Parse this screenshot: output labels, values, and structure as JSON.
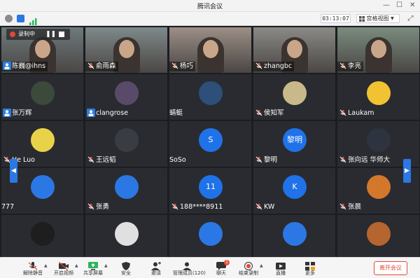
{
  "window": {
    "title": "腾讯会议"
  },
  "toolbar": {
    "timer": "03:13:07",
    "view_label": "宫格视图"
  },
  "recording": {
    "label": "录制中"
  },
  "participants": [
    {
      "name": "陈巍@ihns",
      "type": "video",
      "mic": "blue"
    },
    {
      "name": "俞雨森",
      "type": "video",
      "mic": "muted"
    },
    {
      "name": "杨巧",
      "type": "video",
      "mic": "muted"
    },
    {
      "name": "zhangbc",
      "type": "video",
      "mic": "muted"
    },
    {
      "name": "李亮",
      "type": "video",
      "mic": "muted"
    },
    {
      "name": "张万辉",
      "type": "avatar",
      "mic": "blue"
    },
    {
      "name": "clangrose",
      "type": "avatar",
      "mic": "blue"
    },
    {
      "name": "蜻蜓",
      "type": "avatar",
      "mic": "none"
    },
    {
      "name": "侯知军",
      "type": "avatar",
      "mic": "muted"
    },
    {
      "name": "Laukam",
      "type": "avatar",
      "mic": "muted"
    },
    {
      "name": "He Luo",
      "type": "avatar",
      "mic": "muted"
    },
    {
      "name": "王远韬",
      "type": "avatar",
      "mic": "muted"
    },
    {
      "name": "SoSo",
      "type": "letter",
      "letter": "S",
      "mic": "none"
    },
    {
      "name": "黎明",
      "type": "letter",
      "letter": "黎明",
      "mic": "muted"
    },
    {
      "name": "张向远 华师大",
      "type": "avatar",
      "mic": "muted"
    },
    {
      "name": "777",
      "type": "avatar",
      "mic": "none"
    },
    {
      "name": "张勇",
      "type": "avatar",
      "mic": "muted"
    },
    {
      "name": "188****8911",
      "type": "letter",
      "letter": "11",
      "mic": "muted"
    },
    {
      "name": "KW",
      "type": "letter",
      "letter": "K",
      "mic": "muted"
    },
    {
      "name": "张晨",
      "type": "avatar",
      "mic": "muted"
    },
    {
      "name": "",
      "type": "avatar",
      "mic": "none"
    },
    {
      "name": "",
      "type": "avatar",
      "mic": "none"
    },
    {
      "name": "",
      "type": "avatar",
      "mic": "none"
    },
    {
      "name": "",
      "type": "avatar",
      "mic": "none"
    },
    {
      "name": "",
      "type": "avatar",
      "mic": "none"
    }
  ],
  "bottombar": {
    "items": [
      {
        "label": "解除静音",
        "icon": "mic-off-icon"
      },
      {
        "label": "开启视频",
        "icon": "camera-off-icon"
      },
      {
        "label": "共享屏幕",
        "icon": "share-screen-icon"
      },
      {
        "label": "安全",
        "icon": "shield-icon"
      },
      {
        "label": "邀请",
        "icon": "invite-icon"
      },
      {
        "label": "管理成员(120)",
        "icon": "members-icon"
      },
      {
        "label": "聊天",
        "icon": "chat-icon",
        "badge": "1"
      },
      {
        "label": "结束录制",
        "icon": "record-icon"
      },
      {
        "label": "直播",
        "icon": "live-icon"
      },
      {
        "label": "更多",
        "icon": "more-icon"
      }
    ],
    "leave_label": "离开会议"
  },
  "colors": {
    "accent": "#2b78e4",
    "danger": "#e24a3b",
    "tile": "#2a2b30"
  }
}
